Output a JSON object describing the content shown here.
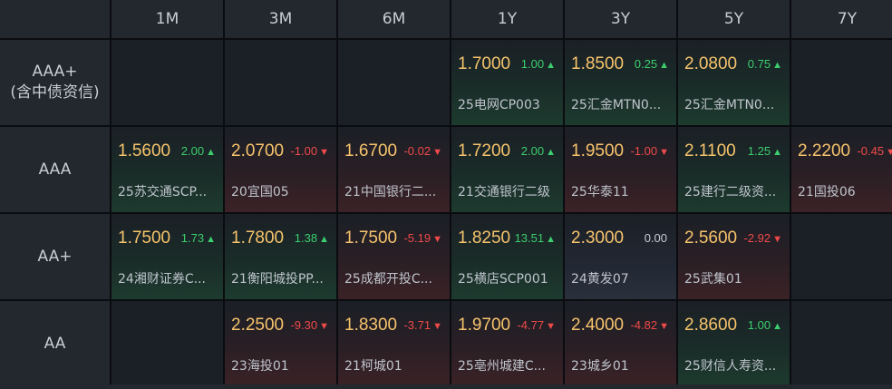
{
  "columns": [
    "1M",
    "3M",
    "6M",
    "1Y",
    "3Y",
    "5Y",
    "7Y"
  ],
  "rows": [
    {
      "label_line1": "AAA+",
      "label_line2": "(含中债资信)",
      "cells": [
        null,
        null,
        null,
        {
          "price": "1.7000",
          "change": "1.00",
          "dir": "up",
          "arrow": "▲",
          "bond": "25电网CP003"
        },
        {
          "price": "1.8500",
          "change": "0.25",
          "dir": "up",
          "arrow": "▲",
          "bond": "25汇金MTN0..."
        },
        {
          "price": "2.0800",
          "change": "0.75",
          "dir": "up",
          "arrow": "▲",
          "bond": "25汇金MTN0..."
        },
        null
      ]
    },
    {
      "label_line1": "AAA",
      "label_line2": "",
      "cells": [
        {
          "price": "1.5600",
          "change": "2.00",
          "dir": "up",
          "arrow": "▲",
          "bond": "25苏交通SCP..."
        },
        {
          "price": "2.0700",
          "change": "-1.00",
          "dir": "down",
          "arrow": "▼",
          "bond": "20宜国05"
        },
        {
          "price": "1.6700",
          "change": "-0.02",
          "dir": "down",
          "arrow": "▼",
          "bond": "21中国银行二..."
        },
        {
          "price": "1.7200",
          "change": "2.00",
          "dir": "up",
          "arrow": "▲",
          "bond": "21交通银行二级"
        },
        {
          "price": "1.9500",
          "change": "-1.00",
          "dir": "down",
          "arrow": "▼",
          "bond": "25华泰11"
        },
        {
          "price": "2.1100",
          "change": "1.25",
          "dir": "up",
          "arrow": "▲",
          "bond": "25建行二级资..."
        },
        {
          "price": "2.2200",
          "change": "-0.45",
          "dir": "down",
          "arrow": "▼",
          "bond": "21国投06"
        }
      ]
    },
    {
      "label_line1": "AA+",
      "label_line2": "",
      "cells": [
        {
          "price": "1.7500",
          "change": "1.73",
          "dir": "up",
          "arrow": "▲",
          "bond": "24湘财证券C..."
        },
        {
          "price": "1.7800",
          "change": "1.38",
          "dir": "up",
          "arrow": "▲",
          "bond": "21衡阳城投PP..."
        },
        {
          "price": "1.7500",
          "change": "-5.19",
          "dir": "down",
          "arrow": "▼",
          "bond": "25成都开投C..."
        },
        {
          "price": "1.8250",
          "change": "13.51",
          "dir": "up",
          "arrow": "▲",
          "bond": "25横店SCP001"
        },
        {
          "price": "2.3000",
          "change": "0.00",
          "dir": "flat",
          "arrow": "",
          "bond": "24黄发07"
        },
        {
          "price": "2.5600",
          "change": "-2.92",
          "dir": "down",
          "arrow": "▼",
          "bond": "25武集01"
        },
        null
      ]
    },
    {
      "label_line1": "AA",
      "label_line2": "",
      "cells": [
        null,
        {
          "price": "2.2500",
          "change": "-9.30",
          "dir": "down",
          "arrow": "▼",
          "bond": "23海投01"
        },
        {
          "price": "1.8300",
          "change": "-3.71",
          "dir": "down",
          "arrow": "▼",
          "bond": "21柯城01"
        },
        {
          "price": "1.9700",
          "change": "-4.77",
          "dir": "down",
          "arrow": "▼",
          "bond": "25亳州城建C..."
        },
        {
          "price": "2.4000",
          "change": "-4.82",
          "dir": "down",
          "arrow": "▼",
          "bond": "23城乡01"
        },
        {
          "price": "2.8600",
          "change": "1.00",
          "dir": "up",
          "arrow": "▲",
          "bond": "25财信人寿资..."
        },
        null
      ]
    }
  ],
  "colors": {
    "price": "#f7c46c",
    "up": "#3ccf6d",
    "down": "#f04a4a",
    "header_bg": "#23272e",
    "cell_bg": "#1b1f26"
  }
}
